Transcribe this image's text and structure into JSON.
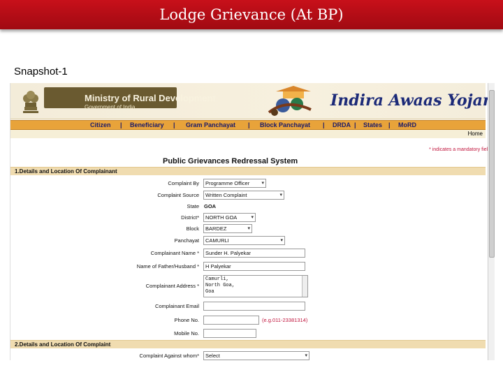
{
  "slide": {
    "title": "Lodge Grievance (At BP)",
    "snapshot_label": "Snapshot-1"
  },
  "header": {
    "ministry_name": "Ministry of Rural Development",
    "ministry_sub": "Government of India",
    "scheme_name": "Indira Awaas Yojana"
  },
  "nav": {
    "items": [
      "Citizen",
      "Beneficiary",
      "Gram Panchayat",
      "Block Panchayat",
      "DRDA",
      "States",
      "MoRD"
    ],
    "separator": "|",
    "home": "Home"
  },
  "form": {
    "mandatory_note": "* indicates a mandatory field",
    "title": "Public Grievances Redressal System",
    "section1": "1.Details and Location Of Complainant",
    "section2": "2.Details and Location Of Complaint",
    "complaint_by": {
      "label": "Complaint By",
      "value": "Programme Officer"
    },
    "complaint_source": {
      "label": "Complaint Source",
      "value": "Written Complaint"
    },
    "state": {
      "label": "State",
      "value": "GOA"
    },
    "district": {
      "label": "District*",
      "value": "NORTH GOA"
    },
    "block": {
      "label": "Block",
      "value": "BARDEZ"
    },
    "panchayat": {
      "label": "Panchayat",
      "value": "CAMURLI"
    },
    "complainant_name": {
      "label": "Complainant Name *",
      "value": "Sunder H. Palyekar"
    },
    "father_name": {
      "label": "Name of Father/Husband *",
      "value": "H Palyekar"
    },
    "address": {
      "label": "Complainant Address *",
      "lines": [
        "Camurli,",
        "North Goa,",
        "Goa"
      ]
    },
    "email": {
      "label": "Complainant Email",
      "value": ""
    },
    "phone": {
      "label": "Phone No.",
      "value": "",
      "hint": "(e.g.011-23381314)"
    },
    "mobile": {
      "label": "Mobile No.",
      "value": ""
    },
    "complaint_against": {
      "label": "Complaint Against whom*",
      "value": "Select"
    }
  }
}
